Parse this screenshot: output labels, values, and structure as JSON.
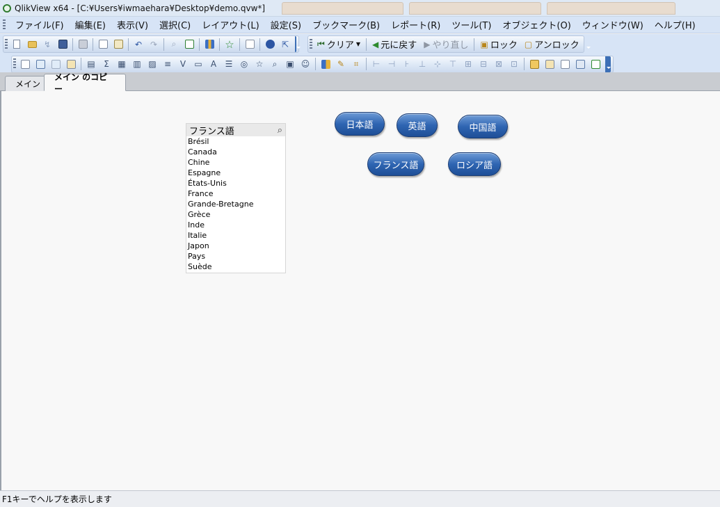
{
  "window": {
    "title": "QlikView x64 - [C:¥Users¥iwmaehara¥Desktop¥demo.qvw*]",
    "app_icon": "qlikview-icon"
  },
  "menubar": {
    "items": [
      {
        "label": "ファイル(F)"
      },
      {
        "label": "編集(E)"
      },
      {
        "label": "表示(V)"
      },
      {
        "label": "選択(C)"
      },
      {
        "label": "レイアウト(L)"
      },
      {
        "label": "設定(S)"
      },
      {
        "label": "ブックマーク(B)"
      },
      {
        "label": "レポート(R)"
      },
      {
        "label": "ツール(T)"
      },
      {
        "label": "オブジェクト(O)"
      },
      {
        "label": "ウィンドウ(W)"
      },
      {
        "label": "ヘルプ(H)"
      }
    ]
  },
  "toolbar_design": {
    "icons": [
      "new-icon",
      "open-icon",
      "reload-icon",
      "save-icon",
      "print-icon",
      "edit-script-icon",
      "reload-data-icon",
      "undo-icon",
      "redo-icon",
      "search-icon",
      "select-fields-icon",
      "chart-icon",
      "bookmark-star-icon",
      "edit-module-icon",
      "help-icon",
      "context-help-icon"
    ]
  },
  "toolbar_navigation": {
    "clear_label": "クリア",
    "back_label": "元に戻す",
    "forward_label": "やり直し",
    "lock_label": "ロック",
    "unlock_label": "アンロック"
  },
  "tabs": [
    {
      "label": "メイン",
      "active": false
    },
    {
      "label": "メイン のコピー",
      "active": true
    }
  ],
  "listbox": {
    "title": "フランス語",
    "items": [
      "Brésil",
      "Canada",
      "Chine",
      "Espagne",
      "États-Unis",
      "France",
      "Grande-Bretagne",
      "Grèce",
      "Inde",
      "Italie",
      "Japon",
      "Pays",
      "Suède"
    ]
  },
  "buttons": {
    "japanese": "日本語",
    "english": "英語",
    "chinese": "中国語",
    "french": "フランス語",
    "russian": "ロシア語"
  },
  "status": {
    "text": "F1キーでヘルプを表示します"
  },
  "colors": {
    "accent": "#2f65b2",
    "toolbar_bg": "#d7e4f6"
  }
}
